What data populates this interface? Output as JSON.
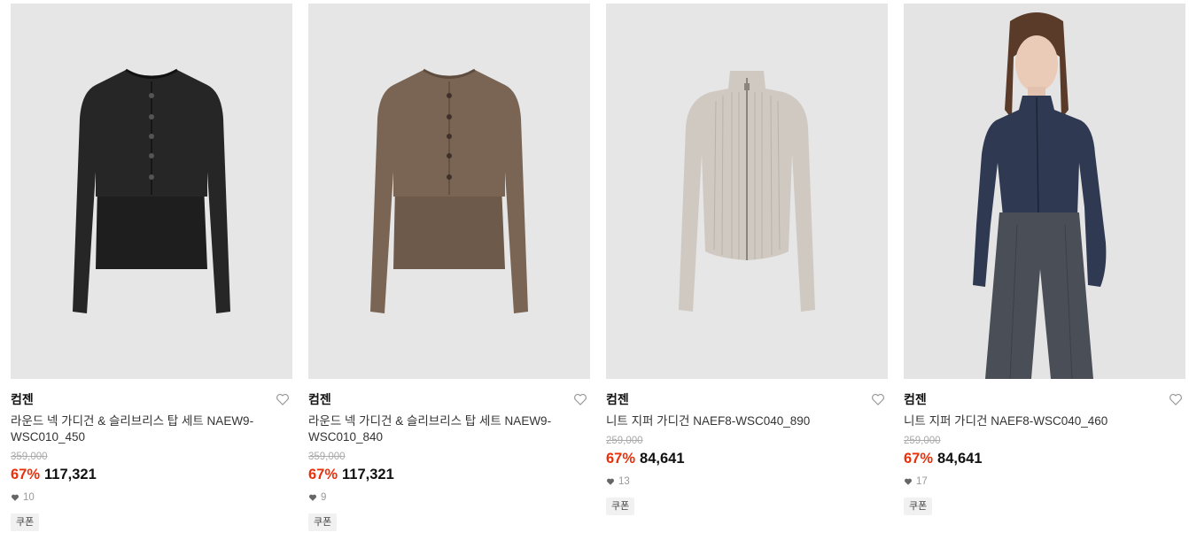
{
  "products": [
    {
      "brand": "컴젠",
      "name": "라운드 넥 가디건 & 슬리브리스 탑 세트 NAEW9-WSC010_450",
      "original_price": "359,000",
      "discount_rate": "67%",
      "price": "117,321",
      "likes": "10",
      "badge": "쿠폰",
      "image": "black-cardigan-set",
      "color": "#262626"
    },
    {
      "brand": "컴젠",
      "name": "라운드 넥 가디건 & 슬리브리스 탑 세트 NAEW9-WSC010_840",
      "original_price": "359,000",
      "discount_rate": "67%",
      "price": "117,321",
      "likes": "9",
      "badge": "쿠폰",
      "image": "brown-cardigan-set",
      "color": "#7a6555"
    },
    {
      "brand": "컴젠",
      "name": "니트 지퍼 가디건 NAEF8-WSC040_890",
      "original_price": "259,000",
      "discount_rate": "67%",
      "price": "84,641",
      "likes": "13",
      "badge": "쿠폰",
      "image": "beige-zip-cardigan",
      "color": "#cfc9c2"
    },
    {
      "brand": "컴젠",
      "name": "니트 지퍼 가디건 NAEF8-WSC040_460",
      "original_price": "259,000",
      "discount_rate": "67%",
      "price": "84,641",
      "likes": "17",
      "badge": "쿠폰",
      "image": "navy-zip-cardigan-model",
      "color": "#2f3a52"
    }
  ],
  "colors": {
    "discount": "#e8300b",
    "thumb_bg": "#e6e6e6",
    "strike": "#aaaaaa"
  }
}
